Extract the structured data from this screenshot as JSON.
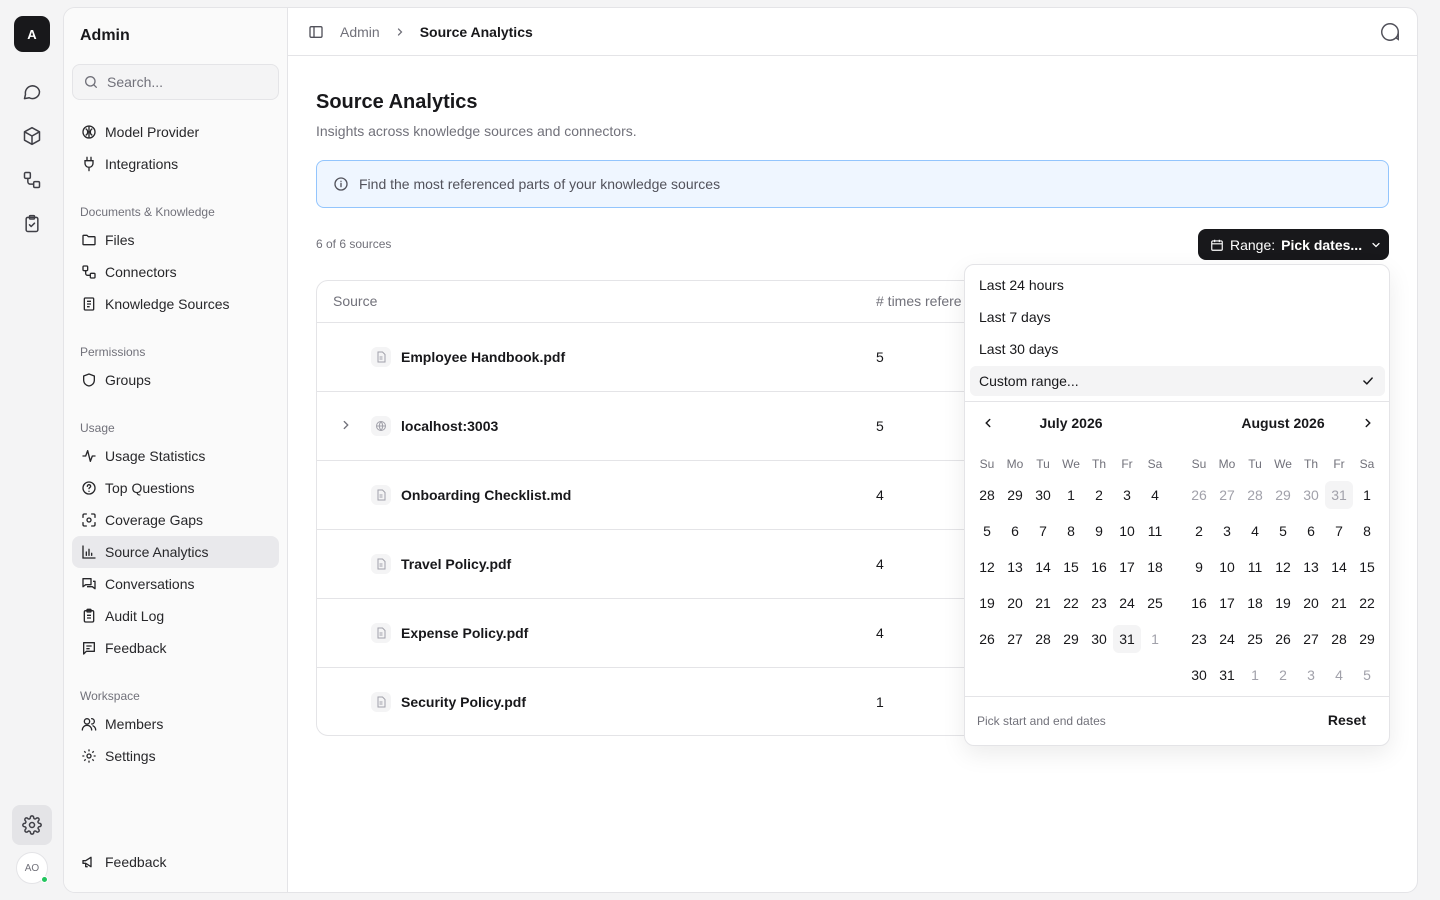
{
  "rail": {
    "logo": "A",
    "avatar": "AO",
    "icons": [
      "chat-icon",
      "cube-icon",
      "workflow-icon",
      "clipboard-check-icon"
    ],
    "settings_icon": "gear-icon"
  },
  "sidebar": {
    "title": "Admin",
    "search_placeholder": "Search...",
    "top_items": [
      {
        "label": "Model Provider",
        "icon": "brain-icon"
      },
      {
        "label": "Integrations",
        "icon": "plug-icon"
      }
    ],
    "sections": [
      {
        "title": "Documents & Knowledge",
        "items": [
          {
            "label": "Files",
            "icon": "folder-icon"
          },
          {
            "label": "Connectors",
            "icon": "connector-icon"
          },
          {
            "label": "Knowledge Sources",
            "icon": "book-icon"
          }
        ]
      },
      {
        "title": "Permissions",
        "items": [
          {
            "label": "Groups",
            "icon": "shield-icon"
          }
        ]
      },
      {
        "title": "Usage",
        "items": [
          {
            "label": "Usage Statistics",
            "icon": "activity-icon"
          },
          {
            "label": "Top Questions",
            "icon": "help-circle-icon"
          },
          {
            "label": "Coverage Gaps",
            "icon": "scan-icon"
          },
          {
            "label": "Source Analytics",
            "icon": "bar-chart-icon",
            "active": true
          },
          {
            "label": "Conversations",
            "icon": "messages-icon"
          },
          {
            "label": "Audit Log",
            "icon": "clipboard-icon"
          },
          {
            "label": "Feedback",
            "icon": "message-square-text-icon"
          }
        ]
      },
      {
        "title": "Workspace",
        "items": [
          {
            "label": "Members",
            "icon": "users-icon"
          },
          {
            "label": "Settings",
            "icon": "gear-icon"
          }
        ]
      }
    ],
    "footer_feedback": "Feedback"
  },
  "header": {
    "breadcrumb_parent": "Admin",
    "breadcrumb_current": "Source Analytics"
  },
  "page": {
    "title": "Source Analytics",
    "subtitle": "Insights across knowledge sources and connectors.",
    "info": "Find the most referenced parts of your knowledge sources",
    "count": "6 of 6 sources",
    "range_label": "Range:",
    "range_value": "Pick dates..."
  },
  "table": {
    "columns": [
      "Source",
      "# times refere"
    ],
    "rows": [
      {
        "name": "Employee Handbook.pdf",
        "count": "5",
        "icon": "file-icon",
        "expandable": false
      },
      {
        "name": "localhost:3003",
        "count": "5",
        "icon": "globe-icon",
        "expandable": true
      },
      {
        "name": "Onboarding Checklist.md",
        "count": "4",
        "icon": "file-icon",
        "expandable": false
      },
      {
        "name": "Travel Policy.pdf",
        "count": "4",
        "icon": "file-icon",
        "expandable": false
      },
      {
        "name": "Expense Policy.pdf",
        "count": "4",
        "icon": "file-icon",
        "expandable": false
      },
      {
        "name": "Security Policy.pdf",
        "count": "1",
        "icon": "file-icon",
        "expandable": false
      }
    ]
  },
  "range_popover": {
    "options": [
      {
        "label": "Last 24 hours",
        "selected": false
      },
      {
        "label": "Last 7 days",
        "selected": false
      },
      {
        "label": "Last 30 days",
        "selected": false
      },
      {
        "label": "Custom range...",
        "selected": true
      }
    ],
    "weekdays": [
      "Su",
      "Mo",
      "Tu",
      "We",
      "Th",
      "Fr",
      "Sa"
    ],
    "months": [
      {
        "title": "July 2026",
        "weeks": [
          [
            "28",
            "29",
            "30",
            "1",
            "2",
            "3",
            "4"
          ],
          [
            "5",
            "6",
            "7",
            "8",
            "9",
            "10",
            "11"
          ],
          [
            "12",
            "13",
            "14",
            "15",
            "16",
            "17",
            "18"
          ],
          [
            "19",
            "20",
            "21",
            "22",
            "23",
            "24",
            "25"
          ],
          [
            "26",
            "27",
            "28",
            "29",
            "30",
            "31",
            "1"
          ]
        ],
        "outside_first": 0,
        "outside_last": 1,
        "highlight": "31"
      },
      {
        "title": "August 2026",
        "weeks": [
          [
            "26",
            "27",
            "28",
            "29",
            "30",
            "31",
            "1"
          ],
          [
            "2",
            "3",
            "4",
            "5",
            "6",
            "7",
            "8"
          ],
          [
            "9",
            "10",
            "11",
            "12",
            "13",
            "14",
            "15"
          ],
          [
            "16",
            "17",
            "18",
            "19",
            "20",
            "21",
            "22"
          ],
          [
            "23",
            "24",
            "25",
            "26",
            "27",
            "28",
            "29"
          ],
          [
            "30",
            "31",
            "1",
            "2",
            "3",
            "4",
            "5"
          ]
        ],
        "outside_first": 6,
        "outside_last": 5,
        "highlight_prev": "31"
      }
    ],
    "footer_hint": "Pick start and end dates",
    "reset": "Reset"
  }
}
